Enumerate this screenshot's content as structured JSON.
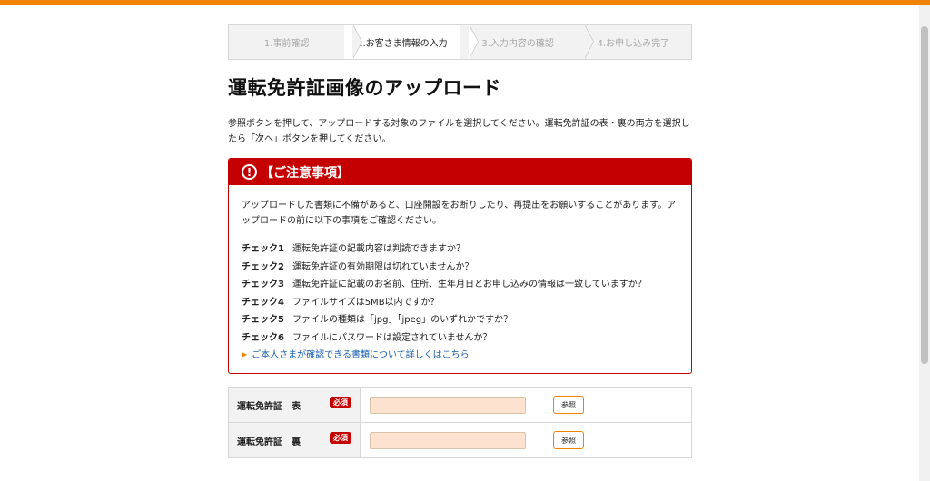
{
  "steps": [
    {
      "label": "1.事前確認",
      "active": false
    },
    {
      "label": "2.お客さま情報の入力",
      "active": true
    },
    {
      "label": "3.入力内容の確認",
      "active": false
    },
    {
      "label": "4.お申し込み完了",
      "active": false
    }
  ],
  "page_title": "運転免許証画像のアップロード",
  "intro": "参照ボタンを押して、アップロードする対象のファイルを選択してください。運転免許証の表・裏の両方を選択したら「次へ」ボタンを押してください。",
  "caution": {
    "icon": "!",
    "heading": "【ご注意事項】",
    "text": "アップロードした書類に不備があると、口座開設をお断りしたり、再提出をお願いすることがあります。アップロードの前に以下の事項をご確認ください。",
    "checks": [
      {
        "label": "チェック1",
        "text": "運転免許証の記載内容は判読できますか？"
      },
      {
        "label": "チェック2",
        "text": "運転免許証の有効期限は切れていませんか？"
      },
      {
        "label": "チェック3",
        "text": "運転免許証に記載のお名前、住所、生年月日とお申し込みの情報は一致していますか？"
      },
      {
        "label": "チェック4",
        "text": "ファイルサイズは5MB以内ですか？"
      },
      {
        "label": "チェック5",
        "text": "ファイルの種類は「jpg」「jpeg」のいずれかですか？"
      },
      {
        "label": "チェック6",
        "text": "ファイルにパスワードは設定されていませんか？"
      }
    ],
    "link": "ご本人さまが確認できる書類について詳しくはこちら"
  },
  "upload": {
    "rows": [
      {
        "label": "運転免許証　表",
        "required": "必須",
        "browse": "参照"
      },
      {
        "label": "運転免許証　裏",
        "required": "必須",
        "browse": "参照"
      }
    ]
  },
  "colors": {
    "accent": "#f08300",
    "alert": "#c40000",
    "input_bg": "#fde3cf"
  }
}
